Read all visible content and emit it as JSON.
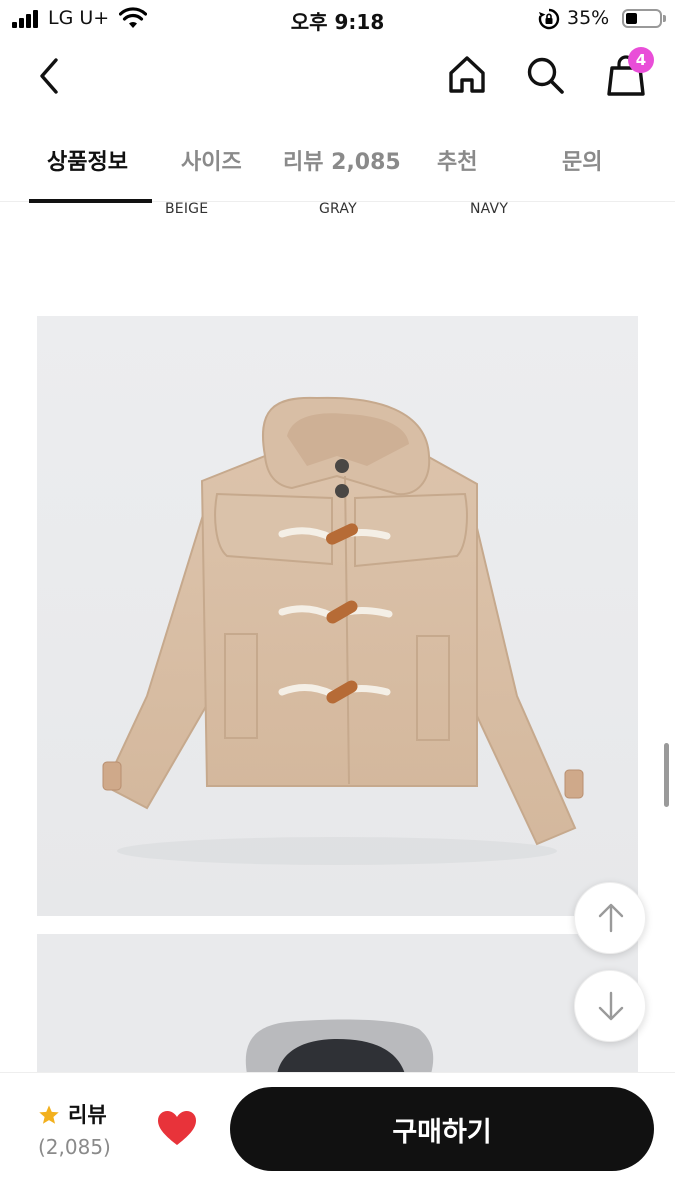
{
  "status_bar": {
    "carrier": "LG U+",
    "time": "오후 9:18",
    "battery": "35%",
    "battery_level": 0.35
  },
  "header": {
    "back_icon": "chevron-left-icon",
    "home_icon": "home-icon",
    "search_icon": "search-icon",
    "cart_icon": "shopping-bag-icon",
    "cart_count": "4",
    "badge_color": "#e94ed8"
  },
  "tabs": [
    {
      "label": "상품정보",
      "active": true
    },
    {
      "label": "사이즈",
      "active": false
    },
    {
      "label": "리뷰 2,085",
      "active": false
    },
    {
      "label": "추천",
      "active": false
    },
    {
      "label": "문의",
      "active": false
    }
  ],
  "color_options": [
    "BEIGE",
    "GRAY",
    "NAVY"
  ],
  "scroll_buttons": {
    "up_icon": "arrow-up-icon",
    "down_icon": "arrow-down-icon"
  },
  "bottom_bar": {
    "review_label": "리뷰",
    "review_count": "(2,085)",
    "star_color": "#f2b01e",
    "heart_color": "#e8333a",
    "buy_label": "구매하기"
  }
}
